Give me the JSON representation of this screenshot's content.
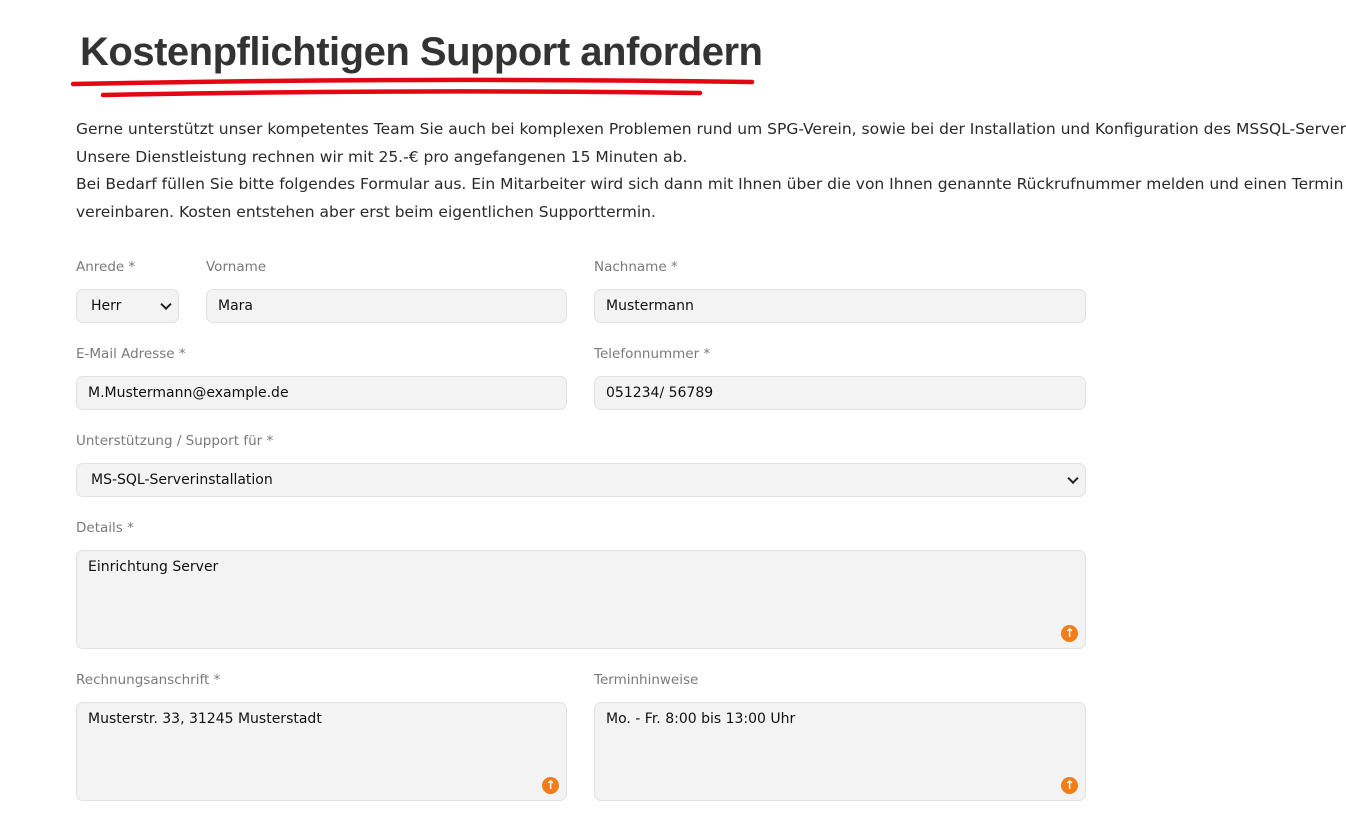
{
  "page": {
    "title": "Kostenpflichtigen Support anfordern",
    "intro": [
      "Gerne unterstützt unser kompetentes Team Sie auch bei komplexen Problemen rund um SPG-Verein, sowie bei der Installation und Konfiguration des MSSQL-Servers.",
      "Unsere Dienstleistung rechnen wir mit 25.-€ pro angefangenen 15 Minuten ab.",
      "Bei Bedarf füllen Sie bitte folgendes Formular aus. Ein Mitarbeiter wird sich dann mit Ihnen über die von Ihnen genannte Rückrufnummer melden und einen Termin",
      "vereinbaren. Kosten entstehen aber erst beim eigentlichen Supporttermin."
    ]
  },
  "form": {
    "anrede": {
      "label": "Anrede *",
      "value": "Herr"
    },
    "vorname": {
      "label": "Vorname",
      "value": "Mara"
    },
    "nachname": {
      "label": "Nachname *",
      "value": "Mustermann"
    },
    "email": {
      "label": "E-Mail Adresse *",
      "value": "M.Mustermann@example.de"
    },
    "telefon": {
      "label": "Telefonnummer *",
      "value": "051234/ 56789"
    },
    "support": {
      "label": "Unterstützung / Support für *",
      "value": "MS-SQL-Serverinstallation"
    },
    "details": {
      "label": "Details *",
      "value": "Einrichtung Server"
    },
    "rechnung": {
      "label": "Rechnungsanschrift *",
      "value": "Musterstr. 33, 31245 Musterstadt"
    },
    "termin": {
      "label": "Terminhinweise",
      "value": "Mo. - Fr. 8:00 bis 13:00 Uhr"
    }
  },
  "colors": {
    "accent_underline": "#e30613",
    "resize_handle": "#ef7d1a",
    "field_background": "#f3f3f3"
  },
  "icons": {
    "select_arrow": "chevron-down-icon",
    "textarea_handle": "arrow-up-circle-icon"
  }
}
